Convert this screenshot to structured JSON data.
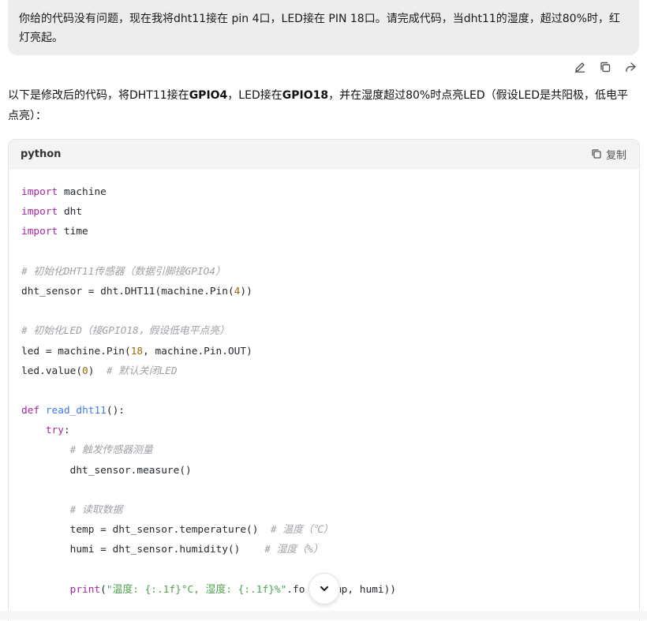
{
  "user_message": {
    "text": "你给的代码没有问题，现在我将dht11接在 pin 4口，LED接在 PIN 18口。请完成代码，当dht11的湿度，超过80%时，红灯亮起。"
  },
  "message_actions": {
    "icons": [
      "edit-icon",
      "copy-icon",
      "share-icon"
    ]
  },
  "answer": {
    "intro_parts": [
      {
        "text": "以下是修改后的代码，将DHT11接在",
        "bold": false
      },
      {
        "text": "GPIO4",
        "bold": true
      },
      {
        "text": "，LED接在",
        "bold": false
      },
      {
        "text": "GPIO18",
        "bold": true
      },
      {
        "text": "，并在湿度超过80%时点亮LED（假设LED是共阳极，低电平点亮）：",
        "bold": false
      }
    ]
  },
  "code_block": {
    "language": "python",
    "copy_label": "复制",
    "lines": [
      [
        [
          "kw",
          "import"
        ],
        [
          "pl",
          " machine"
        ]
      ],
      [
        [
          "kw",
          "import"
        ],
        [
          "pl",
          " dht"
        ]
      ],
      [
        [
          "kw",
          "import"
        ],
        [
          "pl",
          " time"
        ]
      ],
      [],
      [
        [
          "com",
          "# 初始化DHT11传感器（数据引脚接GPIO4）"
        ]
      ],
      [
        [
          "pl",
          "dht_sensor = dht.DHT11(machine.Pin("
        ],
        [
          "num",
          "4"
        ],
        [
          "pl",
          "))"
        ]
      ],
      [],
      [
        [
          "com",
          "# 初始化LED（接GPIO18，假设低电平点亮）"
        ]
      ],
      [
        [
          "pl",
          "led = machine.Pin("
        ],
        [
          "num",
          "18"
        ],
        [
          "pl",
          ", machine.Pin.OUT)"
        ]
      ],
      [
        [
          "pl",
          "led.value("
        ],
        [
          "num",
          "0"
        ],
        [
          "pl",
          ")  "
        ],
        [
          "com",
          "# 默认关闭LED"
        ]
      ],
      [],
      [
        [
          "kw",
          "def"
        ],
        [
          "pl",
          " "
        ],
        [
          "fn",
          "read_dht11"
        ],
        [
          "pl",
          "():"
        ]
      ],
      [
        [
          "pl",
          "    "
        ],
        [
          "kw",
          "try"
        ],
        [
          "pl",
          ":"
        ]
      ],
      [
        [
          "pl",
          "        "
        ],
        [
          "com",
          "# 触发传感器测量"
        ]
      ],
      [
        [
          "pl",
          "        dht_sensor.measure()"
        ]
      ],
      [],
      [
        [
          "pl",
          "        "
        ],
        [
          "com",
          "# 读取数据"
        ]
      ],
      [
        [
          "pl",
          "        temp = dht_sensor.temperature()  "
        ],
        [
          "com",
          "# 温度（℃）"
        ]
      ],
      [
        [
          "pl",
          "        humi = dht_sensor.humidity()    "
        ],
        [
          "com",
          "# 湿度（%）"
        ]
      ],
      [],
      [
        [
          "pl",
          "        "
        ],
        [
          "kw",
          "print"
        ],
        [
          "pl",
          "("
        ],
        [
          "str",
          "\"温度: {:.1f}°C, 湿度: {:.1f}%\""
        ],
        [
          "pl",
          ".fo"
        ],
        [
          "pl",
          "   "
        ],
        [
          "pl",
          "temp, humi))"
        ]
      ]
    ]
  },
  "scroll_button": {
    "icon": "chevron-down-icon"
  }
}
